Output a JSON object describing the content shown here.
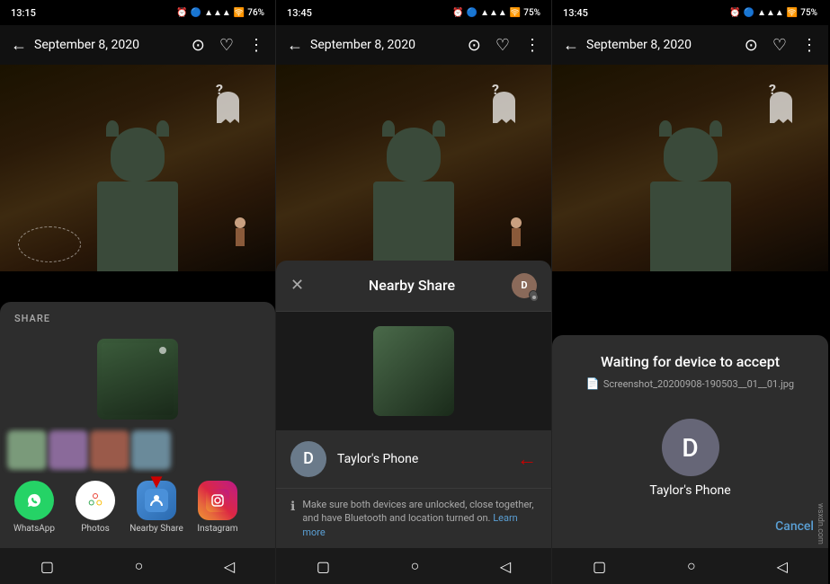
{
  "phones": [
    {
      "id": "phone1",
      "status_bar": {
        "time": "13:15",
        "battery": "76%",
        "signal_icon": "📶"
      },
      "top_bar": {
        "back_label": "←",
        "date": "September 8, 2020"
      },
      "share": {
        "label": "SHARE",
        "apps": [
          {
            "name": "WhatsApp",
            "color": "#25d366"
          },
          {
            "name": "Photos",
            "color": "#fff"
          },
          {
            "name": "Nearby Share",
            "color": "#4a90d9"
          },
          {
            "name": "Instagram",
            "color": "#c13584"
          }
        ]
      }
    },
    {
      "id": "phone2",
      "status_bar": {
        "time": "13:45",
        "battery": "75%"
      },
      "top_bar": {
        "back_label": "←",
        "date": "September 8, 2020"
      },
      "nearby_share": {
        "title": "Nearby Share",
        "device_name": "Taylor's Phone",
        "device_initial": "D",
        "info_text": "Make sure both devices are unlocked, close together, and have Bluetooth and location turned on.",
        "learn_more": "Learn more"
      }
    },
    {
      "id": "phone3",
      "status_bar": {
        "time": "13:45",
        "battery": "75%"
      },
      "top_bar": {
        "back_label": "←",
        "date": "September 8, 2020"
      },
      "waiting": {
        "title": "Waiting for device to accept",
        "filename": "Screenshot_20200908-190503__01__01.jpg",
        "device_name": "Taylor's Phone",
        "device_initial": "D",
        "cancel_label": "Cancel"
      }
    }
  ],
  "watermark": "wsxdn.com"
}
